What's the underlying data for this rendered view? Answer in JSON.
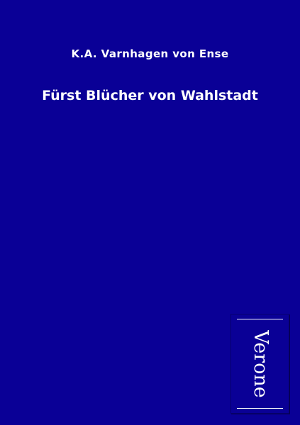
{
  "cover": {
    "author": "K.A. Varnhagen von Ense",
    "title": "Fürst Blücher von Wahlstadt",
    "publisher": "Verone"
  },
  "colors": {
    "background": "#0a0096",
    "text": "#ffffff"
  }
}
